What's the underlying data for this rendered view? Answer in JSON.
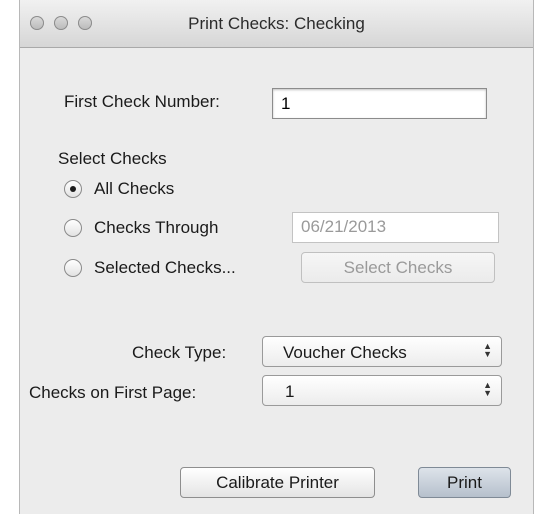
{
  "window": {
    "title": "Print Checks: Checking"
  },
  "first_check": {
    "label": "First Check Number:",
    "value": "1"
  },
  "select_checks": {
    "heading": "Select Checks",
    "options": [
      {
        "label": "All Checks",
        "selected": true
      },
      {
        "label": "Checks Through",
        "selected": false
      },
      {
        "label": "Selected Checks...",
        "selected": false
      }
    ],
    "through_date": "06/21/2013",
    "select_button_label": "Select Checks"
  },
  "check_type": {
    "label": "Check Type:",
    "value": "Voucher Checks"
  },
  "checks_first_page": {
    "label": "Checks on First Page:",
    "value": "1"
  },
  "buttons": {
    "calibrate_label": "Calibrate Printer",
    "print_label": "Print"
  }
}
